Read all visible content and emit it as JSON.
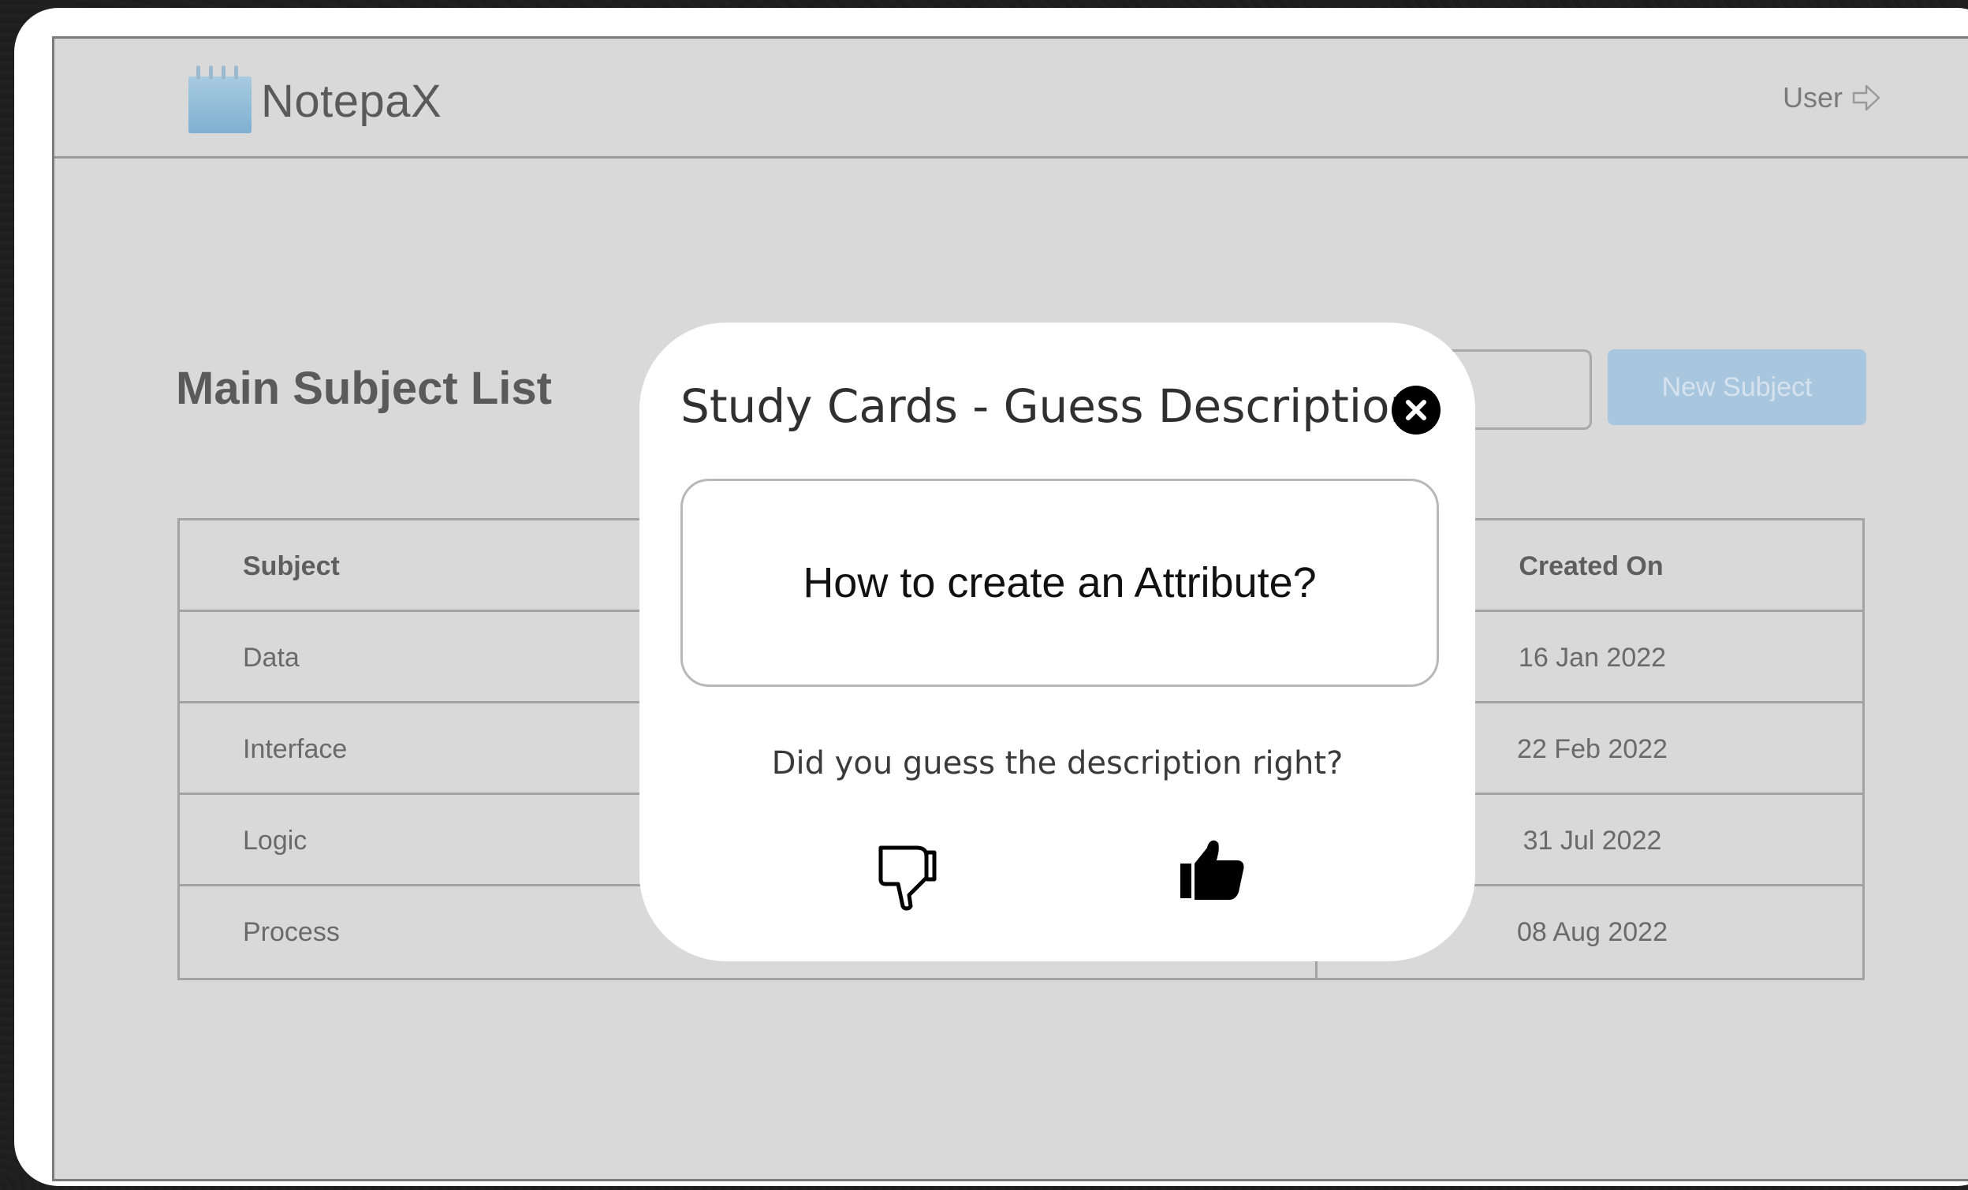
{
  "app": {
    "brand": "NotepaX",
    "user_label": "User"
  },
  "page": {
    "title": "Main Subject List",
    "new_button_label": "New Subject"
  },
  "table": {
    "headers": {
      "subject": "Subject",
      "created_on": "Created On"
    },
    "rows": [
      {
        "subject": "Data",
        "created_on": "16 Jan 2022"
      },
      {
        "subject": "Interface",
        "created_on": "22 Feb 2022"
      },
      {
        "subject": "Logic",
        "created_on": "31 Jul 2022"
      },
      {
        "subject": "Process",
        "created_on": "08 Aug 2022"
      }
    ]
  },
  "modal": {
    "title": "Study Cards - Guess Description",
    "card_text": "How to create an Attribute?",
    "question": "Did you guess the description right?"
  },
  "icons": {
    "logo": "notepad-icon",
    "user": "arrow-right-outline-icon",
    "close": "close-circle-icon",
    "dislike": "thumbs-down-outline-icon",
    "like": "thumbs-up-filled-icon"
  },
  "colors": {
    "screen_bg": "#d9d9d9",
    "accent_button": "#a9c6df",
    "modal_bg": "#ffffff"
  }
}
